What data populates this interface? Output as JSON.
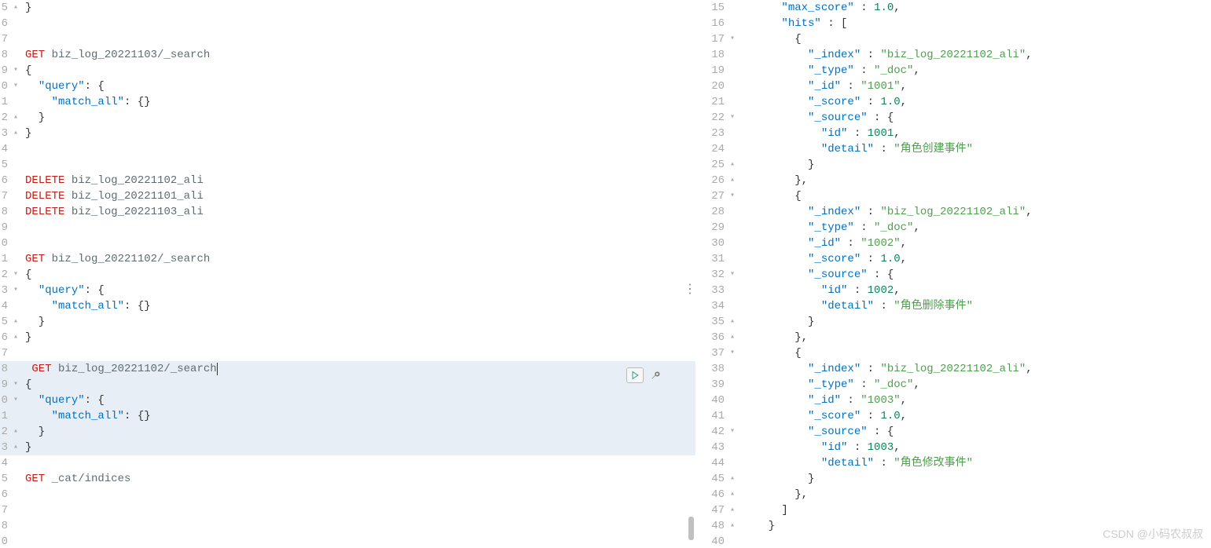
{
  "left": {
    "lines": [
      {
        "n": "5",
        "fold": "▴",
        "code": [
          {
            "t": "}",
            "c": "tk-brace"
          }
        ]
      },
      {
        "n": "6",
        "fold": "",
        "code": []
      },
      {
        "n": "7",
        "fold": "",
        "code": []
      },
      {
        "n": "8",
        "fold": "",
        "code": [
          {
            "t": "GET",
            "c": "tk-method"
          },
          {
            "t": " biz_log_20221103/_search",
            "c": "tk-path"
          }
        ]
      },
      {
        "n": "9",
        "fold": "▾",
        "code": [
          {
            "t": "{",
            "c": "tk-brace"
          }
        ]
      },
      {
        "n": "0",
        "fold": "▾",
        "code": [
          {
            "t": "  ",
            "c": ""
          },
          {
            "t": "\"query\"",
            "c": "tk-key"
          },
          {
            "t": ": {",
            "c": "tk-brace"
          }
        ]
      },
      {
        "n": "1",
        "fold": "",
        "code": [
          {
            "t": "    ",
            "c": ""
          },
          {
            "t": "\"match_all\"",
            "c": "tk-key"
          },
          {
            "t": ": {}",
            "c": "tk-brace"
          }
        ]
      },
      {
        "n": "2",
        "fold": "▴",
        "code": [
          {
            "t": "  }",
            "c": "tk-brace"
          }
        ]
      },
      {
        "n": "3",
        "fold": "▴",
        "code": [
          {
            "t": "}",
            "c": "tk-brace"
          }
        ]
      },
      {
        "n": "4",
        "fold": "",
        "code": []
      },
      {
        "n": "5",
        "fold": "",
        "code": []
      },
      {
        "n": "6",
        "fold": "",
        "code": [
          {
            "t": "DELETE",
            "c": "tk-method"
          },
          {
            "t": " biz_log_20221102_ali",
            "c": "tk-path"
          }
        ]
      },
      {
        "n": "7",
        "fold": "",
        "code": [
          {
            "t": "DELETE",
            "c": "tk-method"
          },
          {
            "t": " biz_log_20221101_ali",
            "c": "tk-path"
          }
        ]
      },
      {
        "n": "8",
        "fold": "",
        "code": [
          {
            "t": "DELETE",
            "c": "tk-method"
          },
          {
            "t": " biz_log_20221103_ali",
            "c": "tk-path"
          }
        ]
      },
      {
        "n": "9",
        "fold": "",
        "code": []
      },
      {
        "n": "0",
        "fold": "",
        "code": []
      },
      {
        "n": "1",
        "fold": "",
        "code": [
          {
            "t": "GET",
            "c": "tk-method"
          },
          {
            "t": " biz_log_20221102/_search",
            "c": "tk-path"
          }
        ]
      },
      {
        "n": "2",
        "fold": "▾",
        "code": [
          {
            "t": "{",
            "c": "tk-brace"
          }
        ]
      },
      {
        "n": "3",
        "fold": "▾",
        "code": [
          {
            "t": "  ",
            "c": ""
          },
          {
            "t": "\"query\"",
            "c": "tk-key"
          },
          {
            "t": ": {",
            "c": "tk-brace"
          }
        ]
      },
      {
        "n": "4",
        "fold": "",
        "code": [
          {
            "t": "    ",
            "c": ""
          },
          {
            "t": "\"match_all\"",
            "c": "tk-key"
          },
          {
            "t": ": {}",
            "c": "tk-brace"
          }
        ]
      },
      {
        "n": "5",
        "fold": "▴",
        "code": [
          {
            "t": "  }",
            "c": "tk-brace"
          }
        ]
      },
      {
        "n": "6",
        "fold": "▴",
        "code": [
          {
            "t": "}",
            "c": "tk-brace"
          }
        ]
      },
      {
        "n": "7",
        "fold": "",
        "code": []
      },
      {
        "n": "8",
        "fold": "",
        "hl": true,
        "code": [
          {
            "t": " GET",
            "c": "tk-method"
          },
          {
            "t": " biz_log_20221102/_search",
            "c": "tk-path cursor-mark"
          }
        ]
      },
      {
        "n": "9",
        "fold": "▾",
        "hl": true,
        "code": [
          {
            "t": "{",
            "c": "tk-brace"
          }
        ]
      },
      {
        "n": "0",
        "fold": "▾",
        "hl": true,
        "code": [
          {
            "t": "  ",
            "c": ""
          },
          {
            "t": "\"query\"",
            "c": "tk-key"
          },
          {
            "t": ": {",
            "c": "tk-brace"
          }
        ]
      },
      {
        "n": "1",
        "fold": "",
        "hl": true,
        "code": [
          {
            "t": "    ",
            "c": ""
          },
          {
            "t": "\"match_all\"",
            "c": "tk-key"
          },
          {
            "t": ": {}",
            "c": "tk-brace"
          }
        ]
      },
      {
        "n": "2",
        "fold": "▴",
        "hl": true,
        "code": [
          {
            "t": "  }",
            "c": "tk-brace"
          }
        ]
      },
      {
        "n": "3",
        "fold": "▴",
        "hl": true,
        "code": [
          {
            "t": "}",
            "c": "tk-brace"
          }
        ]
      },
      {
        "n": "4",
        "fold": "",
        "code": []
      },
      {
        "n": "5",
        "fold": "",
        "code": [
          {
            "t": "GET",
            "c": "tk-method"
          },
          {
            "t": " _cat/indices",
            "c": "tk-path"
          }
        ]
      },
      {
        "n": "6",
        "fold": "",
        "code": []
      },
      {
        "n": "7",
        "fold": "",
        "code": []
      },
      {
        "n": "8",
        "fold": "",
        "code": []
      },
      {
        "n": "0",
        "fold": "",
        "code": []
      }
    ]
  },
  "right": {
    "lines": [
      {
        "n": "15",
        "fold": "",
        "code": [
          {
            "t": "      ",
            "c": ""
          },
          {
            "t": "\"max_score\"",
            "c": "tk-key"
          },
          {
            "t": " : ",
            "c": "tk-punc"
          },
          {
            "t": "1.0",
            "c": "tk-num"
          },
          {
            "t": ",",
            "c": "tk-punc"
          }
        ]
      },
      {
        "n": "16",
        "fold": "",
        "code": [
          {
            "t": "      ",
            "c": ""
          },
          {
            "t": "\"hits\"",
            "c": "tk-key"
          },
          {
            "t": " : [",
            "c": "tk-punc"
          }
        ]
      },
      {
        "n": "17",
        "fold": "▾",
        "code": [
          {
            "t": "        {",
            "c": "tk-brace"
          }
        ]
      },
      {
        "n": "18",
        "fold": "",
        "code": [
          {
            "t": "          ",
            "c": ""
          },
          {
            "t": "\"_index\"",
            "c": "tk-key"
          },
          {
            "t": " : ",
            "c": "tk-punc"
          },
          {
            "t": "\"biz_log_20221102_ali\"",
            "c": "tk-str"
          },
          {
            "t": ",",
            "c": "tk-punc"
          }
        ]
      },
      {
        "n": "19",
        "fold": "",
        "code": [
          {
            "t": "          ",
            "c": ""
          },
          {
            "t": "\"_type\"",
            "c": "tk-key"
          },
          {
            "t": " : ",
            "c": "tk-punc"
          },
          {
            "t": "\"_doc\"",
            "c": "tk-str"
          },
          {
            "t": ",",
            "c": "tk-punc"
          }
        ]
      },
      {
        "n": "20",
        "fold": "",
        "code": [
          {
            "t": "          ",
            "c": ""
          },
          {
            "t": "\"_id\"",
            "c": "tk-key"
          },
          {
            "t": " : ",
            "c": "tk-punc"
          },
          {
            "t": "\"1001\"",
            "c": "tk-str"
          },
          {
            "t": ",",
            "c": "tk-punc"
          }
        ]
      },
      {
        "n": "21",
        "fold": "",
        "code": [
          {
            "t": "          ",
            "c": ""
          },
          {
            "t": "\"_score\"",
            "c": "tk-key"
          },
          {
            "t": " : ",
            "c": "tk-punc"
          },
          {
            "t": "1.0",
            "c": "tk-num"
          },
          {
            "t": ",",
            "c": "tk-punc"
          }
        ]
      },
      {
        "n": "22",
        "fold": "▾",
        "code": [
          {
            "t": "          ",
            "c": ""
          },
          {
            "t": "\"_source\"",
            "c": "tk-key"
          },
          {
            "t": " : {",
            "c": "tk-brace"
          }
        ]
      },
      {
        "n": "23",
        "fold": "",
        "code": [
          {
            "t": "            ",
            "c": ""
          },
          {
            "t": "\"id\"",
            "c": "tk-key"
          },
          {
            "t": " : ",
            "c": "tk-punc"
          },
          {
            "t": "1001",
            "c": "tk-num"
          },
          {
            "t": ",",
            "c": "tk-punc"
          }
        ]
      },
      {
        "n": "24",
        "fold": "",
        "code": [
          {
            "t": "            ",
            "c": ""
          },
          {
            "t": "\"detail\"",
            "c": "tk-key"
          },
          {
            "t": " : ",
            "c": "tk-punc"
          },
          {
            "t": "\"角色创建事件\"",
            "c": "tk-str"
          }
        ]
      },
      {
        "n": "25",
        "fold": "▴",
        "code": [
          {
            "t": "          }",
            "c": "tk-brace"
          }
        ]
      },
      {
        "n": "26",
        "fold": "▴",
        "code": [
          {
            "t": "        },",
            "c": "tk-brace"
          }
        ]
      },
      {
        "n": "27",
        "fold": "▾",
        "code": [
          {
            "t": "        {",
            "c": "tk-brace"
          }
        ]
      },
      {
        "n": "28",
        "fold": "",
        "code": [
          {
            "t": "          ",
            "c": ""
          },
          {
            "t": "\"_index\"",
            "c": "tk-key"
          },
          {
            "t": " : ",
            "c": "tk-punc"
          },
          {
            "t": "\"biz_log_20221102_ali\"",
            "c": "tk-str"
          },
          {
            "t": ",",
            "c": "tk-punc"
          }
        ]
      },
      {
        "n": "29",
        "fold": "",
        "code": [
          {
            "t": "          ",
            "c": ""
          },
          {
            "t": "\"_type\"",
            "c": "tk-key"
          },
          {
            "t": " : ",
            "c": "tk-punc"
          },
          {
            "t": "\"_doc\"",
            "c": "tk-str"
          },
          {
            "t": ",",
            "c": "tk-punc"
          }
        ]
      },
      {
        "n": "30",
        "fold": "",
        "code": [
          {
            "t": "          ",
            "c": ""
          },
          {
            "t": "\"_id\"",
            "c": "tk-key"
          },
          {
            "t": " : ",
            "c": "tk-punc"
          },
          {
            "t": "\"1002\"",
            "c": "tk-str"
          },
          {
            "t": ",",
            "c": "tk-punc"
          }
        ]
      },
      {
        "n": "31",
        "fold": "",
        "code": [
          {
            "t": "          ",
            "c": ""
          },
          {
            "t": "\"_score\"",
            "c": "tk-key"
          },
          {
            "t": " : ",
            "c": "tk-punc"
          },
          {
            "t": "1.0",
            "c": "tk-num"
          },
          {
            "t": ",",
            "c": "tk-punc"
          }
        ]
      },
      {
        "n": "32",
        "fold": "▾",
        "code": [
          {
            "t": "          ",
            "c": ""
          },
          {
            "t": "\"_source\"",
            "c": "tk-key"
          },
          {
            "t": " : {",
            "c": "tk-brace"
          }
        ]
      },
      {
        "n": "33",
        "fold": "",
        "code": [
          {
            "t": "            ",
            "c": ""
          },
          {
            "t": "\"id\"",
            "c": "tk-key"
          },
          {
            "t": " : ",
            "c": "tk-punc"
          },
          {
            "t": "1002",
            "c": "tk-num"
          },
          {
            "t": ",",
            "c": "tk-punc"
          }
        ]
      },
      {
        "n": "34",
        "fold": "",
        "code": [
          {
            "t": "            ",
            "c": ""
          },
          {
            "t": "\"detail\"",
            "c": "tk-key"
          },
          {
            "t": " : ",
            "c": "tk-punc"
          },
          {
            "t": "\"角色删除事件\"",
            "c": "tk-str"
          }
        ]
      },
      {
        "n": "35",
        "fold": "▴",
        "code": [
          {
            "t": "          }",
            "c": "tk-brace"
          }
        ]
      },
      {
        "n": "36",
        "fold": "▴",
        "code": [
          {
            "t": "        },",
            "c": "tk-brace"
          }
        ]
      },
      {
        "n": "37",
        "fold": "▾",
        "code": [
          {
            "t": "        {",
            "c": "tk-brace"
          }
        ]
      },
      {
        "n": "38",
        "fold": "",
        "code": [
          {
            "t": "          ",
            "c": ""
          },
          {
            "t": "\"_index\"",
            "c": "tk-key"
          },
          {
            "t": " : ",
            "c": "tk-punc"
          },
          {
            "t": "\"biz_log_20221102_ali\"",
            "c": "tk-str"
          },
          {
            "t": ",",
            "c": "tk-punc"
          }
        ]
      },
      {
        "n": "39",
        "fold": "",
        "code": [
          {
            "t": "          ",
            "c": ""
          },
          {
            "t": "\"_type\"",
            "c": "tk-key"
          },
          {
            "t": " : ",
            "c": "tk-punc"
          },
          {
            "t": "\"_doc\"",
            "c": "tk-str"
          },
          {
            "t": ",",
            "c": "tk-punc"
          }
        ]
      },
      {
        "n": "40",
        "fold": "",
        "code": [
          {
            "t": "          ",
            "c": ""
          },
          {
            "t": "\"_id\"",
            "c": "tk-key"
          },
          {
            "t": " : ",
            "c": "tk-punc"
          },
          {
            "t": "\"1003\"",
            "c": "tk-str"
          },
          {
            "t": ",",
            "c": "tk-punc"
          }
        ]
      },
      {
        "n": "41",
        "fold": "",
        "code": [
          {
            "t": "          ",
            "c": ""
          },
          {
            "t": "\"_score\"",
            "c": "tk-key"
          },
          {
            "t": " : ",
            "c": "tk-punc"
          },
          {
            "t": "1.0",
            "c": "tk-num"
          },
          {
            "t": ",",
            "c": "tk-punc"
          }
        ]
      },
      {
        "n": "42",
        "fold": "▾",
        "code": [
          {
            "t": "          ",
            "c": ""
          },
          {
            "t": "\"_source\"",
            "c": "tk-key"
          },
          {
            "t": " : {",
            "c": "tk-brace"
          }
        ]
      },
      {
        "n": "43",
        "fold": "",
        "code": [
          {
            "t": "            ",
            "c": ""
          },
          {
            "t": "\"id\"",
            "c": "tk-key"
          },
          {
            "t": " : ",
            "c": "tk-punc"
          },
          {
            "t": "1003",
            "c": "tk-num"
          },
          {
            "t": ",",
            "c": "tk-punc"
          }
        ]
      },
      {
        "n": "44",
        "fold": "",
        "code": [
          {
            "t": "            ",
            "c": ""
          },
          {
            "t": "\"detail\"",
            "c": "tk-key"
          },
          {
            "t": " : ",
            "c": "tk-punc"
          },
          {
            "t": "\"角色修改事件\"",
            "c": "tk-str"
          }
        ]
      },
      {
        "n": "45",
        "fold": "▴",
        "code": [
          {
            "t": "          }",
            "c": "tk-brace"
          }
        ]
      },
      {
        "n": "46",
        "fold": "▴",
        "code": [
          {
            "t": "        },",
            "c": "tk-brace"
          }
        ]
      },
      {
        "n": "47",
        "fold": "▴",
        "code": [
          {
            "t": "      ]",
            "c": "tk-brace"
          }
        ]
      },
      {
        "n": "48",
        "fold": "▴",
        "code": [
          {
            "t": "    }",
            "c": "tk-brace"
          }
        ]
      },
      {
        "n": "40",
        "fold": "",
        "code": []
      }
    ]
  },
  "watermark": "CSDN @小码农叔叔"
}
